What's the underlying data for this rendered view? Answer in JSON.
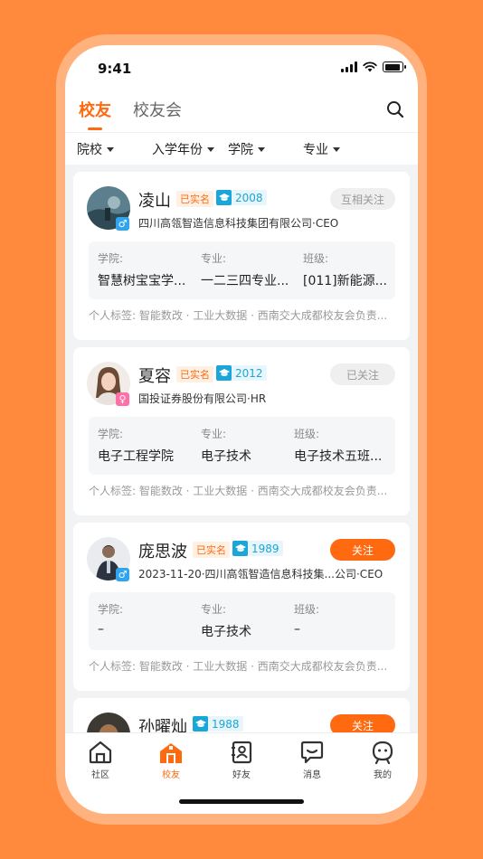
{
  "status": {
    "time": "9:41"
  },
  "tabs": [
    {
      "label": "校友",
      "active": true
    },
    {
      "label": "校友会",
      "active": false
    }
  ],
  "filters": [
    {
      "label": "院校"
    },
    {
      "label": "入学年份"
    },
    {
      "label": "学院"
    },
    {
      "label": "专业"
    }
  ],
  "cards": [
    {
      "name": "凌山",
      "real_badge": "已实名",
      "year": "2008",
      "gender": "male",
      "gender_symbol": "♂",
      "follow": "互相关注",
      "follow_style": "grey",
      "company": "四川高瓴智造信息科技集团有限公司·CEO",
      "college_label": "学院:",
      "college": "智慧树宝宝学...",
      "major_label": "专业:",
      "major": "一二三四专业...",
      "class_label": "班级:",
      "class": "[011]新能源...",
      "tags": "个人标签: 智能数改 · 工业大数据 · 西南交大成都校友会负责..."
    },
    {
      "name": "夏容",
      "real_badge": "已实名",
      "year": "2012",
      "gender": "female",
      "gender_symbol": "♀",
      "follow": "已关注",
      "follow_style": "grey",
      "company": "国投证券股份有限公司·HR",
      "college_label": "学院:",
      "college": "电子工程学院",
      "major_label": "专业:",
      "major": "电子技术",
      "class_label": "班级:",
      "class": "电子技术五班...",
      "tags": "个人标签: 智能数改 · 工业大数据 · 西南交大成都校友会负责..."
    },
    {
      "name": "庞思波",
      "real_badge": "已实名",
      "year": "1989",
      "gender": "male",
      "gender_symbol": "♂",
      "follow": "关注",
      "follow_style": "orange",
      "company": "2023-11-20·四川高瓴智造信息科技集...公司·CEO",
      "college_label": "学院:",
      "college": "–",
      "major_label": "专业:",
      "major": "电子技术",
      "class_label": "班级:",
      "class": "–",
      "tags": "个人标签: 智能数改 · 工业大数据 · 西南交大成都校友会负责..."
    },
    {
      "name": "孙曜灿",
      "real_badge": "",
      "year": "1988",
      "gender": "male",
      "gender_symbol": "♂",
      "follow": "关注",
      "follow_style": "orange",
      "company": "",
      "college_label": "",
      "college": "",
      "major_label": "",
      "major": "",
      "class_label": "",
      "class": "",
      "tags": ""
    }
  ],
  "tabbar": [
    {
      "label": "社区",
      "icon": "home-icon",
      "active": false
    },
    {
      "label": "校友",
      "icon": "school-icon",
      "active": true
    },
    {
      "label": "好友",
      "icon": "contacts-icon",
      "active": false
    },
    {
      "label": "消息",
      "icon": "message-icon",
      "active": false
    },
    {
      "label": "我的",
      "icon": "profile-icon",
      "active": false
    }
  ],
  "colors": {
    "accent": "#FF6A10",
    "background": "#FF8A3D",
    "year_badge": "#1AA6D8"
  }
}
